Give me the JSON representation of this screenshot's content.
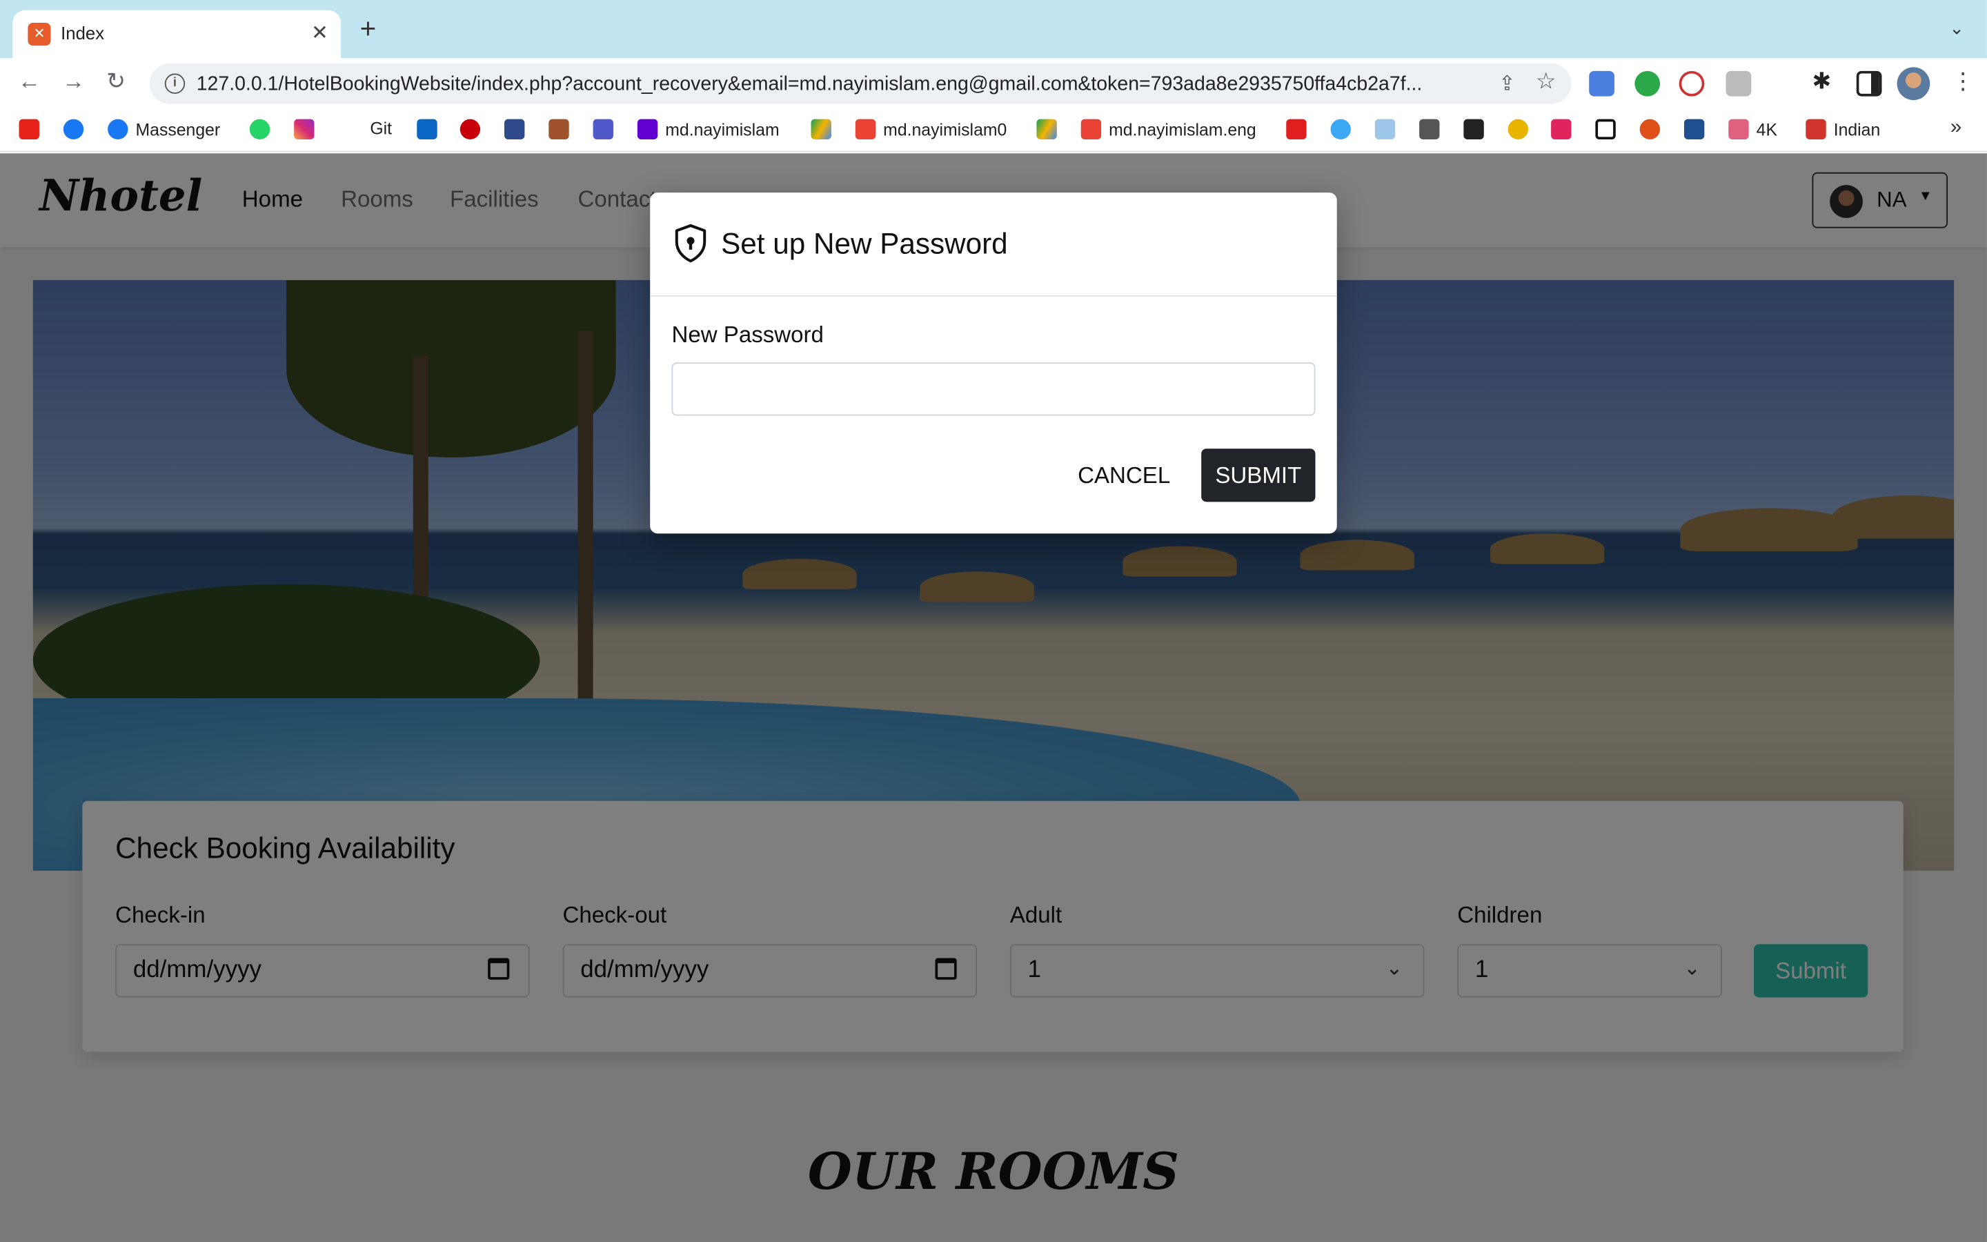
{
  "browser": {
    "tab_title": "Index",
    "url": "127.0.0.1/HotelBookingWebsite/index.php?account_recovery&email=md.nayimislam.eng@gmail.com&token=793ada8e2935750ffa4cb2a7f...",
    "bookmarks": [
      "Massenger",
      "Git",
      "md.nayimislam",
      "md.nayimislam0",
      "md.nayimislam.eng",
      "4K",
      "Indian"
    ]
  },
  "site": {
    "brand": "Nhotel",
    "nav": [
      "Home",
      "Rooms",
      "Facilities",
      "Contact"
    ],
    "user_initials": "NA"
  },
  "availability": {
    "title": "Check Booking Availability",
    "checkin_label": "Check-in",
    "checkin_value": "dd/mm/yyyy",
    "checkout_label": "Check-out",
    "checkout_value": "dd/mm/yyyy",
    "adult_label": "Adult",
    "adult_value": "1",
    "children_label": "Children",
    "children_value": "1",
    "submit_label": "Submit"
  },
  "rooms_heading": "OUR ROOMS",
  "modal": {
    "title": "Set up New Password",
    "password_label": "New Password",
    "password_value": "",
    "cancel_label": "CANCEL",
    "submit_label": "SUBMIT"
  },
  "colors": {
    "accent_teal": "#2ec1ac",
    "dark_button": "#212529",
    "tabstrip": "#c2e5f2"
  }
}
